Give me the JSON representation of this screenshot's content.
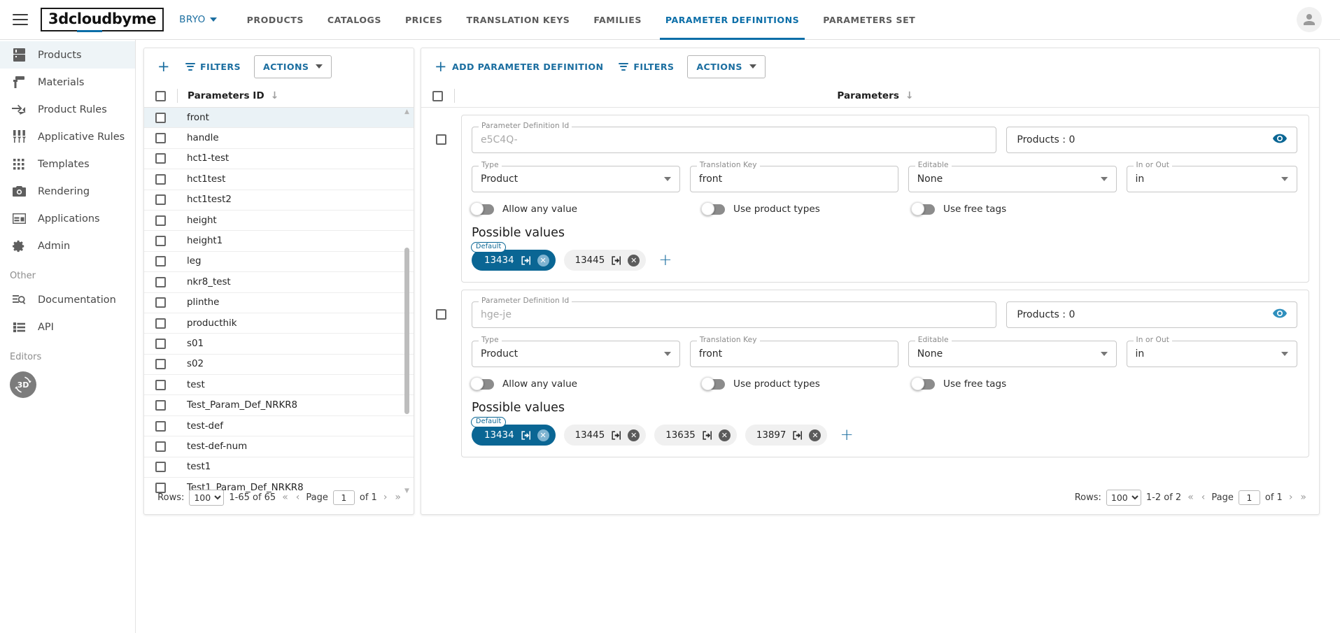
{
  "topbar": {
    "menu_icon": "hamburger-menu-icon",
    "logo_text": "3dcloudbyme",
    "brand": "BRYO",
    "nav": [
      {
        "label": "PRODUCTS",
        "active": false
      },
      {
        "label": "CATALOGS",
        "active": false
      },
      {
        "label": "PRICES",
        "active": false
      },
      {
        "label": "TRANSLATION KEYS",
        "active": false
      },
      {
        "label": "FAMILIES",
        "active": false
      },
      {
        "label": "PARAMETER DEFINITIONS",
        "active": true
      },
      {
        "label": "PARAMETERS SET",
        "active": false
      }
    ],
    "avatar_icon": "user-avatar-icon"
  },
  "sidebar": {
    "items": [
      {
        "label": "Products",
        "icon": "products-icon",
        "active": true
      },
      {
        "label": "Materials",
        "icon": "materials-roller-icon",
        "active": false
      },
      {
        "label": "Product Rules",
        "icon": "product-rules-arrows-icon",
        "active": false
      },
      {
        "label": "Applicative Rules",
        "icon": "applicative-rules-sliders-icon",
        "active": false
      },
      {
        "label": "Templates",
        "icon": "templates-grid-icon",
        "active": false
      },
      {
        "label": "Rendering",
        "icon": "rendering-camera-icon",
        "active": false
      },
      {
        "label": "Applications",
        "icon": "applications-window-icon",
        "active": false
      },
      {
        "label": "Admin",
        "icon": "admin-gear-icon",
        "active": false
      }
    ],
    "group_other": "Other",
    "other_items": [
      {
        "label": "Documentation",
        "icon": "documentation-search-icon"
      },
      {
        "label": "API",
        "icon": "api-list-icon"
      }
    ],
    "group_editors": "Editors",
    "editor_badge": "3D"
  },
  "left_panel": {
    "toolbar": {
      "add_label": "",
      "add_icon": "plus-icon",
      "filters_label": "FILTERS",
      "filters_icon": "filter-icon",
      "actions_label": "ACTIONS",
      "actions_caret_icon": "chevron-down-icon"
    },
    "column_header": "Parameters ID",
    "sort_icon": "sort-descending-arrow-icon",
    "rows": [
      {
        "label": "front",
        "selected": true
      },
      {
        "label": "handle",
        "selected": false
      },
      {
        "label": "hct1-test",
        "selected": false
      },
      {
        "label": "hct1test",
        "selected": false
      },
      {
        "label": "hct1test2",
        "selected": false
      },
      {
        "label": "height",
        "selected": false
      },
      {
        "label": "height1",
        "selected": false
      },
      {
        "label": "leg",
        "selected": false
      },
      {
        "label": "nkr8_test",
        "selected": false
      },
      {
        "label": "plinthe",
        "selected": false
      },
      {
        "label": "producthik",
        "selected": false
      },
      {
        "label": "s01",
        "selected": false
      },
      {
        "label": "s02",
        "selected": false
      },
      {
        "label": "test",
        "selected": false
      },
      {
        "label": "Test_Param_Def_NRKR8",
        "selected": false
      },
      {
        "label": "test-def",
        "selected": false
      },
      {
        "label": "test-def-num",
        "selected": false
      },
      {
        "label": "test1",
        "selected": false
      },
      {
        "label": "Test1_Param_Def_NRKR8",
        "selected": false
      }
    ],
    "pager": {
      "rows_label": "Rows:",
      "rows_value": "100",
      "rows_options": [
        "100"
      ],
      "range": "1-65 of 65",
      "page_label": "Page",
      "page_value": "1",
      "of_label": "of 1",
      "first_icon": "«",
      "prev_icon": "‹",
      "next_icon": "›",
      "last_icon": "»"
    }
  },
  "right_panel": {
    "toolbar": {
      "add_label": "ADD PARAMETER DEFINITION",
      "add_icon": "plus-icon",
      "filters_label": "FILTERS",
      "filters_icon": "filter-icon",
      "actions_label": "ACTIONS",
      "actions_caret_icon": "chevron-down-icon"
    },
    "column_header": "Parameters",
    "sort_icon": "sort-descending-arrow-icon",
    "cards": [
      {
        "def_id": {
          "legend": "Parameter Definition Id",
          "value": "e5C4Q-"
        },
        "products": {
          "label": "Products : 0",
          "eye_icon": "eye-visibility-icon"
        },
        "type": {
          "legend": "Type",
          "value": "Product"
        },
        "translation_key": {
          "legend": "Translation Key",
          "value": "front"
        },
        "editable": {
          "legend": "Editable",
          "value": "None"
        },
        "in_or_out": {
          "legend": "In or Out",
          "value": "in"
        },
        "toggles": [
          {
            "label": "Allow any value",
            "on": false
          },
          {
            "label": "Use product types",
            "on": false
          },
          {
            "label": "Use free tags",
            "on": false
          }
        ],
        "possible_values_title": "Possible values",
        "chips": [
          {
            "value": "13434",
            "default": true,
            "badge": "Default"
          },
          {
            "value": "13445",
            "default": false
          }
        ],
        "add_chip_icon": "plus-icon"
      },
      {
        "def_id": {
          "legend": "Parameter Definition Id",
          "value": "hge-je"
        },
        "products": {
          "label": "Products : 0",
          "eye_icon": "eye-visibility-icon"
        },
        "type": {
          "legend": "Type",
          "value": "Product"
        },
        "translation_key": {
          "legend": "Translation Key",
          "value": "front"
        },
        "editable": {
          "legend": "Editable",
          "value": "None"
        },
        "in_or_out": {
          "legend": "In or Out",
          "value": "in"
        },
        "toggles": [
          {
            "label": "Allow any value",
            "on": false
          },
          {
            "label": "Use product types",
            "on": false
          },
          {
            "label": "Use free tags",
            "on": false
          }
        ],
        "possible_values_title": "Possible values",
        "chips": [
          {
            "value": "13434",
            "default": true,
            "badge": "Default"
          },
          {
            "value": "13445",
            "default": false
          },
          {
            "value": "13635",
            "default": false
          },
          {
            "value": "13897",
            "default": false
          }
        ],
        "add_chip_icon": "plus-icon"
      }
    ],
    "pager": {
      "rows_label": "Rows:",
      "rows_value": "100",
      "rows_options": [
        "100"
      ],
      "range": "1-2 of 2",
      "page_label": "Page",
      "page_value": "1",
      "of_label": "of 1",
      "first_icon": "«",
      "prev_icon": "‹",
      "next_icon": "›",
      "last_icon": "»"
    }
  },
  "colors": {
    "accent": "#0b6ea8",
    "chip_default_bg": "#0a6694",
    "selected_row_bg": "#eaf2f6"
  }
}
